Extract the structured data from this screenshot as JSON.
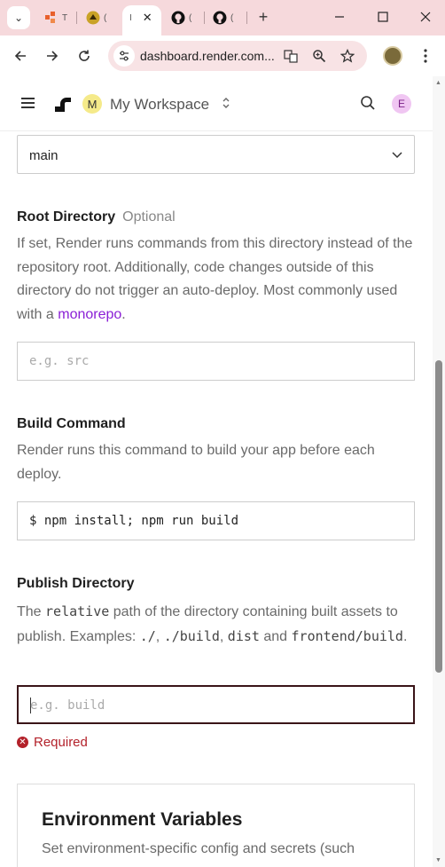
{
  "browser": {
    "tabs": [
      {
        "title": "T",
        "icon": "render-favicon",
        "color": "#e8602c"
      },
      {
        "title": "(",
        "icon": "yellow-favicon",
        "color": "#c9a227"
      },
      {
        "title": "I",
        "icon": "active-tab-favicon",
        "color": "#333333"
      },
      {
        "title": "(",
        "icon": "github-icon",
        "color": "#111111"
      },
      {
        "title": "(",
        "icon": "github-icon",
        "color": "#111111"
      }
    ],
    "url": "dashboard.render.com...",
    "tab_close": "✕",
    "new_tab": "+"
  },
  "header": {
    "workspace_initial": "M",
    "workspace_name": "My Workspace",
    "user_initial": "E"
  },
  "form": {
    "branch": {
      "value": "main"
    },
    "root_directory": {
      "label": "Root Directory",
      "optional": "Optional",
      "desc_before": "If set, Render runs commands from this directory instead of the repository root. Additionally, code changes outside of this directory do not trigger an auto-deploy. Most commonly used with a ",
      "desc_link": "monorepo",
      "desc_after": ".",
      "placeholder": "e.g. src"
    },
    "build_command": {
      "label": "Build Command",
      "desc": "Render runs this command to build your app before each deploy.",
      "value": "$ npm install; npm run build"
    },
    "publish_directory": {
      "label": "Publish Directory",
      "desc_1": "The ",
      "code_1": "relative",
      "desc_2": " path of the directory containing built assets to publish. Examples: ",
      "code_2": "./",
      "desc_3": ", ",
      "code_3": "./build",
      "desc_4": ", ",
      "code_4": "dist",
      "desc_5": " and ",
      "code_5": "frontend/build",
      "desc_6": ".",
      "placeholder": "e.g. build",
      "error": "Required"
    }
  },
  "env": {
    "title": "Environment Variables",
    "desc": "Set environment-specific config and secrets (such"
  },
  "colors": {
    "accent_link": "#8a1fd6",
    "error": "#b3212a",
    "focus_border": "#3a1518"
  }
}
